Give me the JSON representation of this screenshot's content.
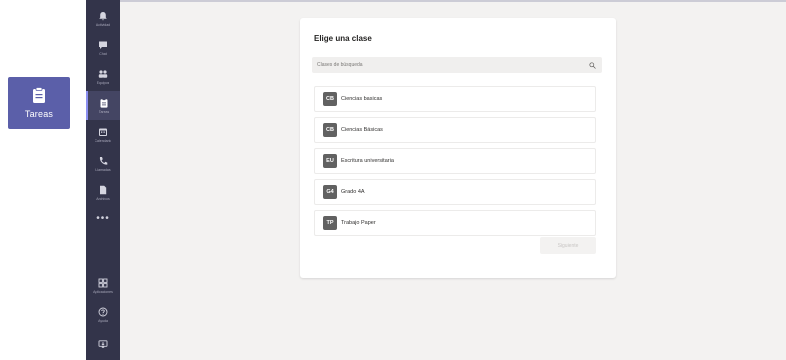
{
  "zoom_tile": {
    "label": "Tareas",
    "icon": "assignments-icon"
  },
  "rail": {
    "items": [
      {
        "name": "Actividad",
        "icon": "bell-icon"
      },
      {
        "name": "Chat",
        "icon": "chat-icon"
      },
      {
        "name": "Equipos",
        "icon": "teams-icon"
      },
      {
        "name": "Tareas",
        "icon": "assignments-icon",
        "active": true
      },
      {
        "name": "Calendario",
        "icon": "calendar-icon"
      },
      {
        "name": "Llamadas",
        "icon": "phone-icon"
      },
      {
        "name": "Archivos",
        "icon": "files-icon"
      }
    ],
    "more": "•••",
    "bottom": [
      {
        "name": "Aplicaciones",
        "icon": "apps-icon"
      },
      {
        "name": "Ayuda",
        "icon": "help-icon"
      },
      {
        "name": "",
        "icon": "device-icon"
      }
    ]
  },
  "dialog": {
    "title": "Elige una clase",
    "search_placeholder": "Clases de búsqueda",
    "classes": [
      {
        "initials": "CB",
        "name": "Ciencias basicas"
      },
      {
        "initials": "CB",
        "name": "Ciencias Básicas"
      },
      {
        "initials": "EU",
        "name": "Escritura universitaria"
      },
      {
        "initials": "G4",
        "name": "Grado 4A"
      },
      {
        "initials": "TP",
        "name": "Trabajo Paper"
      }
    ],
    "next_label": "Siguiente"
  },
  "colors": {
    "rail_bg": "#33344a",
    "accent": "#5b5fa9",
    "canvas_bg": "#f3f2f1",
    "badge_bg": "#616161"
  }
}
